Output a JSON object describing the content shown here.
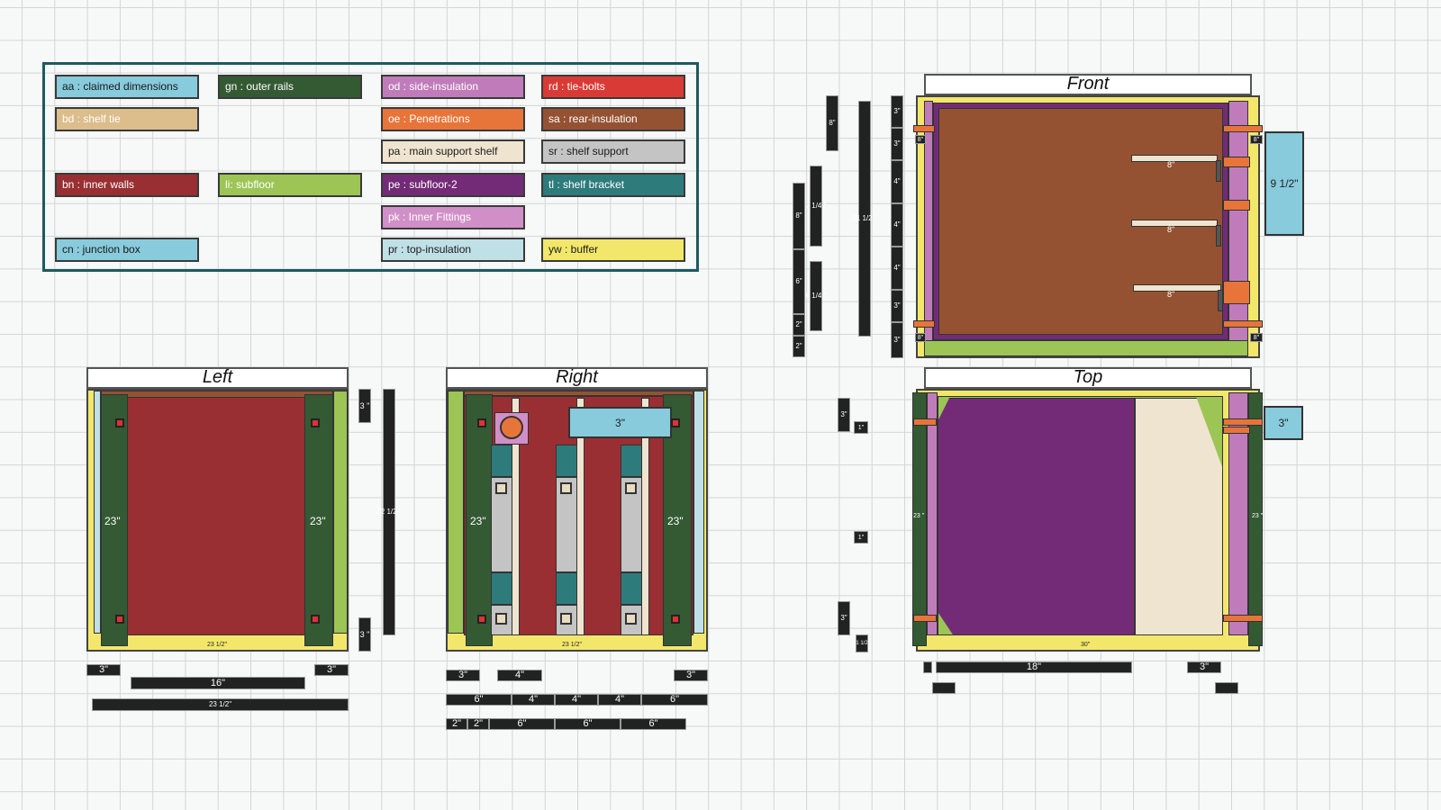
{
  "legend": {
    "items": [
      {
        "code": "aa",
        "text": "aa : claimed dimensions",
        "color": "#87cbdc",
        "text_color": "#1a1a1a"
      },
      {
        "code": "gn",
        "text": "gn : outer rails",
        "color": "#345a34",
        "text_color": "#ffffff"
      },
      {
        "code": "od",
        "text": "od : side-insulation",
        "color": "#c07cba",
        "text_color": "#ffffff"
      },
      {
        "code": "rd",
        "text": "rd : tie-bolts",
        "color": "#da3a35",
        "text_color": "#ffffff"
      },
      {
        "code": "bd",
        "text": "bd : shelf tie",
        "color": "#dcbd8c",
        "text_color": "#ffffff"
      },
      {
        "code": "oe",
        "text": "oe : Penetrations",
        "color": "#e7753a",
        "text_color": "#ffffff"
      },
      {
        "code": "sa",
        "text": "sa : rear-insulation",
        "color": "#955233",
        "text_color": "#ffffff"
      },
      {
        "code": "pa",
        "text": "pa : main support shelf",
        "color": "#efe4cf",
        "text_color": "#1a1a1a"
      },
      {
        "code": "sr",
        "text": "sr : shelf support",
        "color": "#c4c4c4",
        "text_color": "#1a1a1a"
      },
      {
        "code": "bn",
        "text": "bn : inner walls",
        "color": "#992f33",
        "text_color": "#ffffff"
      },
      {
        "code": "li",
        "text": "li: subfloor",
        "color": "#9cc556",
        "text_color": "#ffffff"
      },
      {
        "code": "pe",
        "text": "pe : subfloor-2",
        "color": "#742b77",
        "text_color": "#ffffff"
      },
      {
        "code": "tl",
        "text": "tl : shelf bracket",
        "color": "#2e7b7c",
        "text_color": "#ffffff"
      },
      {
        "code": "pk",
        "text": "pk : Inner Fittings",
        "color": "#d18fc7",
        "text_color": "#ffffff"
      },
      {
        "code": "cn",
        "text": "cn : junction box",
        "color": "#87cbdc",
        "text_color": "#1a1a1a"
      },
      {
        "code": "pr",
        "text": "pr : top-insulation",
        "color": "#bfe0e6",
        "text_color": "#1a1a1a"
      },
      {
        "code": "yw",
        "text": "yw : buffer",
        "color": "#f3e76b",
        "text_color": "#1a1a1a"
      }
    ]
  },
  "views": {
    "front": {
      "title": "Front",
      "shelf_labels": [
        "8\"",
        "8\"",
        "8\""
      ],
      "junction_label": "9 1/2\"",
      "side_labels": [
        "8\"",
        "8\"",
        "8\"",
        "8\""
      ],
      "dims_v1": [
        "8\""
      ],
      "dims_v2": [
        "7 1/4 \"",
        "6 1/4 \""
      ],
      "dims_v3": [
        "8\"",
        "6\"",
        "2\"",
        "2\""
      ],
      "dims_v4": [
        "21 1/2 \""
      ],
      "dims_v5": [
        "3\"",
        "3\"",
        "4\"",
        "4\"",
        "4\"",
        "3\"",
        "3\""
      ]
    },
    "left": {
      "title": "Left",
      "rail_labels": [
        "23\"",
        "23\""
      ],
      "bottom_labels": [
        "23 1/2\""
      ],
      "dims_bottom_row1": [
        "3\"",
        "16\"",
        "3\""
      ],
      "dims_bottom_row2": [
        "23 1/2\""
      ],
      "dims_right": [
        "3 \"",
        "22 1/2 \"",
        "3 \""
      ]
    },
    "right": {
      "title": "Right",
      "rail_labels": [
        "23\"",
        "23\""
      ],
      "junction_label": "3\"",
      "bottom_labels": [
        "23 1/2\""
      ],
      "dims_row1": [
        "3\"",
        "4\"",
        "3\""
      ],
      "dims_row2": [
        "6\"",
        "4\"",
        "4\"",
        "4\"",
        "6\""
      ],
      "dims_row3": [
        "2\"",
        "2\"",
        "6\"",
        "6\"",
        "6\""
      ]
    },
    "top": {
      "title": "Top",
      "junction_label": "3\"",
      "rail_labels": [
        "23 \"",
        "23 \""
      ],
      "bottom_label": "30\"",
      "dims_row1": [
        "18\"",
        "3\""
      ],
      "dims_left": [
        "3\"",
        "1\"",
        "1\"",
        "3\"",
        "1 1/2"
      ]
    }
  }
}
